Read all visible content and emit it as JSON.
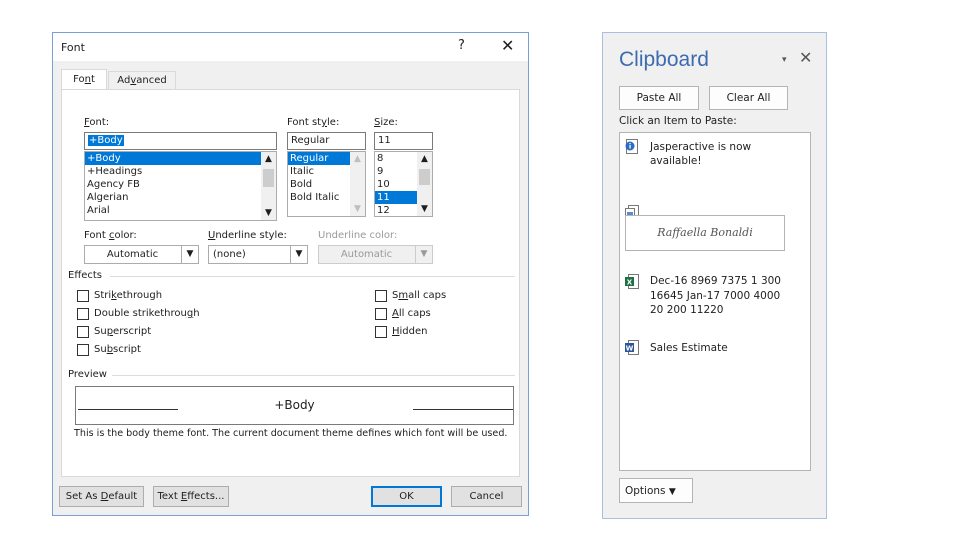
{
  "font_dialog": {
    "title": "Font",
    "help_glyph": "?",
    "close_glyph": "✕",
    "tabs": [
      {
        "label_pre": "Fo",
        "label_u": "n",
        "label_post": "t"
      },
      {
        "label_pre": "Ad",
        "label_u": "v",
        "label_post": "anced"
      }
    ],
    "font": {
      "label_pre": "",
      "label_u": "F",
      "label_post": "ont:",
      "value": "+Body",
      "items": [
        "+Body",
        "+Headings",
        "Agency FB",
        "Algerian",
        "Arial"
      ],
      "selected": "+Body"
    },
    "font_style": {
      "label_pre": "Font st",
      "label_u": "y",
      "label_post": "le:",
      "value": "Regular",
      "items": [
        "Regular",
        "Italic",
        "Bold",
        "Bold Italic"
      ],
      "selected": "Regular"
    },
    "size": {
      "label_pre": "",
      "label_u": "S",
      "label_post": "ize:",
      "value": "11",
      "items": [
        "8",
        "9",
        "10",
        "11",
        "12"
      ],
      "selected": "11"
    },
    "font_color": {
      "label_pre": "Font ",
      "label_u": "c",
      "label_post": "olor:",
      "value": "Automatic"
    },
    "underline_style": {
      "label_pre": "",
      "label_u": "U",
      "label_post": "nderline style:",
      "value": "(none)"
    },
    "underline_color": {
      "label": "Underline color:",
      "value": "Automatic"
    },
    "effects": {
      "label": "Effects",
      "left": [
        {
          "pre": "Stri",
          "u": "k",
          "post": "ethrough"
        },
        {
          "pre": "Double strikethrou",
          "u": "g",
          "post": "h"
        },
        {
          "pre": "Su",
          "u": "p",
          "post": "erscript"
        },
        {
          "pre": "Su",
          "u": "b",
          "post": "script"
        }
      ],
      "right": [
        {
          "pre": "S",
          "u": "m",
          "post": "all caps"
        },
        {
          "pre": "",
          "u": "A",
          "post": "ll caps"
        },
        {
          "pre": "",
          "u": "H",
          "post": "idden"
        }
      ]
    },
    "preview": {
      "label": "Preview",
      "sample": "+Body",
      "description": "This is the body theme font. The current document theme defines which font will be used."
    },
    "buttons": {
      "set_default": {
        "pre": "Set As ",
        "u": "D",
        "post": "efault"
      },
      "text_effects": {
        "pre": "Text ",
        "u": "E",
        "post": "ffects..."
      },
      "ok": "OK",
      "cancel": "Cancel"
    }
  },
  "clipboard": {
    "title": "Clipboard",
    "menu_glyph": "▾",
    "close_glyph": "✕",
    "paste_all": "Paste All",
    "clear_all": "Clear All",
    "hint": "Click an Item to Paste:",
    "items": [
      {
        "icon": "info-icon",
        "line1": "Jasperactive is now",
        "line2": "available!"
      },
      {
        "icon": "image-clip-icon",
        "signature": "Raffaella Bonaldi"
      },
      {
        "icon": "excel-icon",
        "line1": "Dec-16 8969 7375 1 300",
        "line2": "16645 Jan-17 7000 4000",
        "line3": "20 200 11220"
      },
      {
        "icon": "word-icon",
        "line1": "Sales Estimate"
      }
    ],
    "options": "Options",
    "colors": {
      "title": "#3c6bb0",
      "accent": "#0078d7",
      "excel": "#1e7145",
      "word": "#2b579a"
    }
  }
}
